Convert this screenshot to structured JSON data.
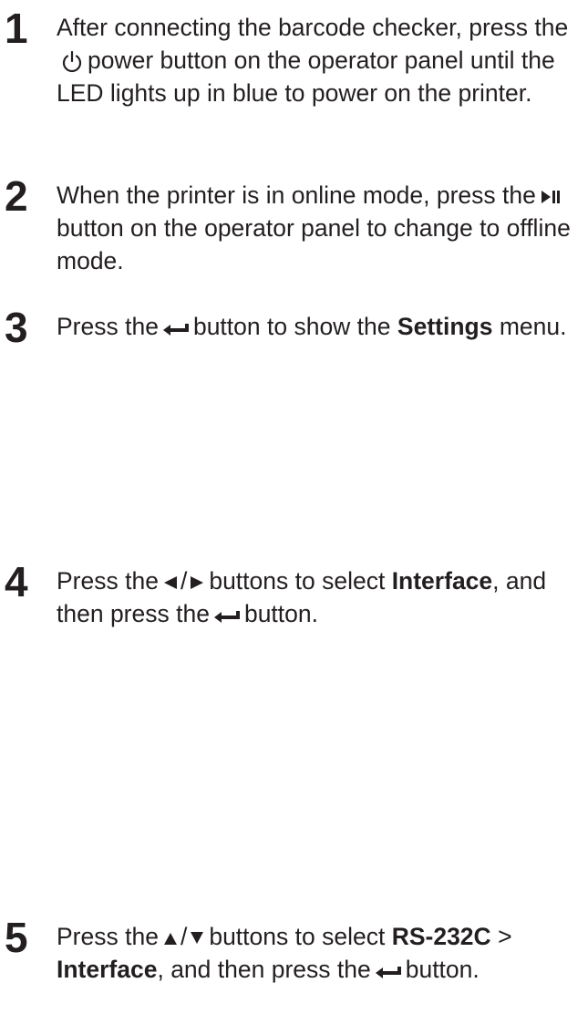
{
  "steps": [
    {
      "number": "1",
      "before_icon": "After connecting the barcode checker, press the",
      "icon": "power-icon",
      "after_icon": "power button on the operator panel until the LED lights up in blue to power on the printer."
    },
    {
      "number": "2",
      "before_icon": "When the printer is in online mode, press the",
      "icon": "play-pause-icon",
      "after_icon": "button on the operator panel to change to offline mode."
    },
    {
      "number": "3",
      "before_icon": "Press the",
      "icon": "enter-icon",
      "mid": "button to show the",
      "bold": "Settings",
      "end": "menu."
    },
    {
      "number": "4",
      "before_icon": "Press the",
      "icons": [
        "left-triangle-icon",
        "right-triangle-icon"
      ],
      "separator": "/",
      "mid": "buttons to select",
      "bold": "Interface",
      "after_bold": ", and then press the",
      "icon_end": "enter-icon",
      "end": "button."
    },
    {
      "number": "5",
      "before_icon": "Press the",
      "icons": [
        "up-triangle-icon",
        "down-triangle-icon"
      ],
      "separator": "/",
      "mid": "buttons to select",
      "bold1": "RS-232C",
      "gt": ">",
      "bold2": "Interface",
      "after_bold": ", and then press the",
      "icon_end": "enter-icon",
      "end": "button."
    }
  ]
}
